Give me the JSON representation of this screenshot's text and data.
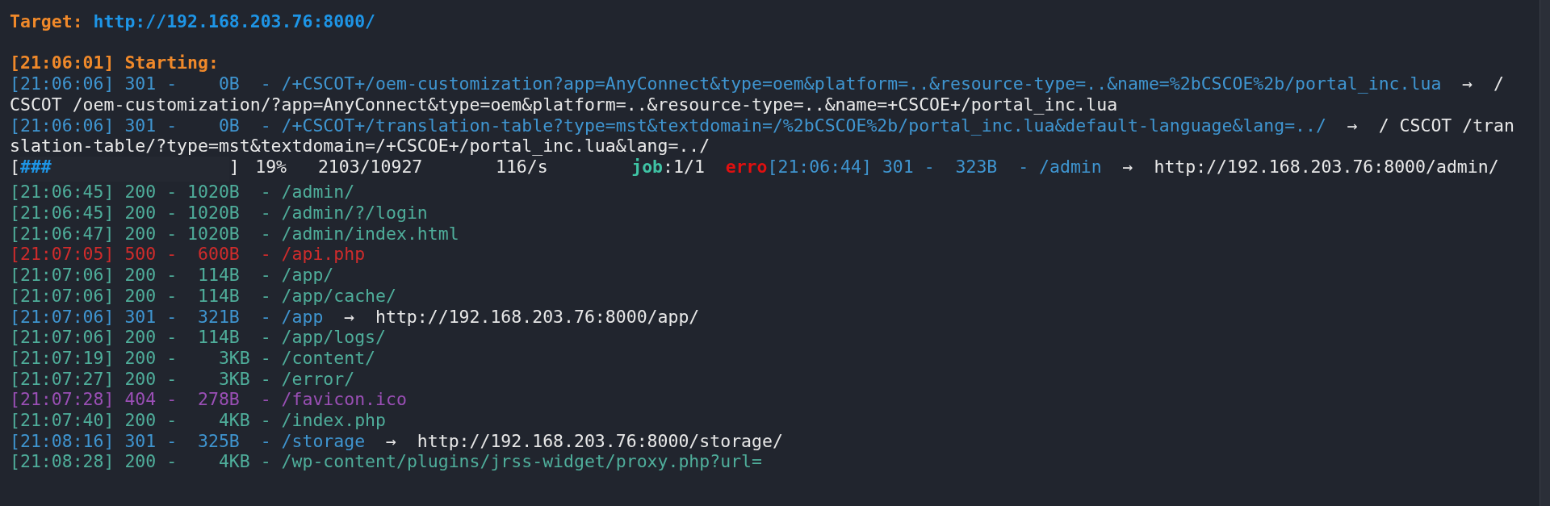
{
  "target": {
    "label": "Target:",
    "url": "http://192.168.203.76:8000/"
  },
  "starting": "[21:06:01] Starting:",
  "entries_before": [
    {
      "text": "[21:06:06] 301 -    0B  - /+CSCOT+/oem-customization?app=AnyConnect&type=oem&platform=..&resource-type=..&name=%2bCSCOE%2b/portal_inc.lua",
      "redirect": "→  / CSCOT /oem-customization/?app=AnyConnect&type=oem&platform=..&resource-type=..&name=+CSCOE+/portal_inc.lua",
      "color": "#3f95d0"
    },
    {
      "text": "[21:06:06] 301 -    0B  - /+CSCOT+/translation-table?type=mst&textdomain=/%2bCSCOE%2b/portal_inc.lua&default-language&lang=../",
      "redirect": "→  / CSCOT /translation-table/?type=mst&textdomain=/+CSCOE+/portal_inc.lua&lang=../",
      "color": "#3f95d0"
    }
  ],
  "progress": {
    "open": "[",
    "fill": "###",
    "close": "]",
    "level": 0.19,
    "percent": "19%",
    "count": "2103/10927",
    "rate": "116/s",
    "job_label": "job",
    "job_value": ":1/1",
    "error_label": "erro",
    "error_entry": {
      "text": "[21:06:44] 301 -  323B  - /admin",
      "redirect": "→  http://192.168.203.76:8000/admin/",
      "color": "#3f95d0"
    }
  },
  "entries": [
    {
      "text": "[21:06:45] 200 - 1020B  - /admin/",
      "color": "#4fae9b"
    },
    {
      "text": "[21:06:45] 200 - 1020B  - /admin/?/login",
      "color": "#4fae9b"
    },
    {
      "text": "[21:06:47] 200 - 1020B  - /admin/index.html",
      "color": "#4fae9b"
    },
    {
      "text": "[21:07:05] 500 -  600B  - /api.php",
      "color": "#d02c2c"
    },
    {
      "text": "[21:07:06] 200 -  114B  - /app/",
      "color": "#4fae9b"
    },
    {
      "text": "[21:07:06] 200 -  114B  - /app/cache/",
      "color": "#4fae9b"
    },
    {
      "text": "[21:07:06] 301 -  321B  - /app",
      "redirect": "→  http://192.168.203.76:8000/app/",
      "color": "#3f95d0"
    },
    {
      "text": "[21:07:06] 200 -  114B  - /app/logs/",
      "color": "#4fae9b"
    },
    {
      "text": "[21:07:19] 200 -    3KB - /content/",
      "color": "#4fae9b"
    },
    {
      "text": "[21:07:27] 200 -    3KB - /error/",
      "color": "#4fae9b"
    },
    {
      "text": "[21:07:28] 404 -  278B  - /favicon.ico",
      "color": "#9a4fb5"
    },
    {
      "text": "[21:07:40] 200 -    4KB - /index.php",
      "color": "#4fae9b"
    },
    {
      "text": "[21:08:16] 301 -  325B  - /storage",
      "redirect": "→  http://192.168.203.76:8000/storage/",
      "color": "#3f95d0"
    },
    {
      "text": "[21:08:28] 200 -    4KB - /wp-content/plugins/jrss-widget/proxy.php?url=",
      "color": "#4fae9b"
    }
  ]
}
